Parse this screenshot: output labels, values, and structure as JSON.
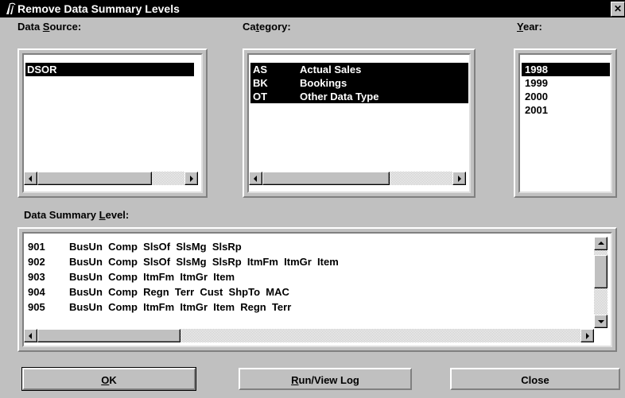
{
  "window": {
    "title": "Remove Data Summary Levels",
    "close_glyph": "✕"
  },
  "labels": {
    "data_source_pre": "Data ",
    "data_source_key": "S",
    "data_source_post": "ource:",
    "category_pre": "Ca",
    "category_key": "t",
    "category_post": "egory:",
    "year_pre": "",
    "year_key": "Y",
    "year_post": "ear:",
    "summary_pre": "Data Summary ",
    "summary_key": "L",
    "summary_post": "evel:"
  },
  "data_sources": [
    {
      "code": "DSOR",
      "selected": true
    }
  ],
  "categories": [
    {
      "code": "AS",
      "name": "Actual Sales",
      "selected": true
    },
    {
      "code": "BK",
      "name": "Bookings",
      "selected": true
    },
    {
      "code": "OT",
      "name": "Other Data Type",
      "selected": true
    }
  ],
  "years": [
    {
      "value": "1998",
      "selected": true
    },
    {
      "value": "1999",
      "selected": false
    },
    {
      "value": "2000",
      "selected": false
    },
    {
      "value": "2001",
      "selected": false
    }
  ],
  "summary_levels": [
    {
      "code": "901",
      "fields": "BusUn  Comp  SlsOf  SlsMg  SlsRp"
    },
    {
      "code": "902",
      "fields": "BusUn  Comp  SlsOf  SlsMg  SlsRp  ItmFm  ItmGr  Item"
    },
    {
      "code": "903",
      "fields": "BusUn  Comp  ItmFm  ItmGr  Item"
    },
    {
      "code": "904",
      "fields": "BusUn  Comp  Regn  Terr  Cust  ShpTo  MAC"
    },
    {
      "code": "905",
      "fields": "BusUn  Comp  ItmFm  ItmGr  Item  Regn  Terr"
    }
  ],
  "buttons": {
    "ok_key": "O",
    "ok_rest": "K",
    "run_key": "R",
    "run_rest": "un/View Log",
    "close": "Close"
  }
}
